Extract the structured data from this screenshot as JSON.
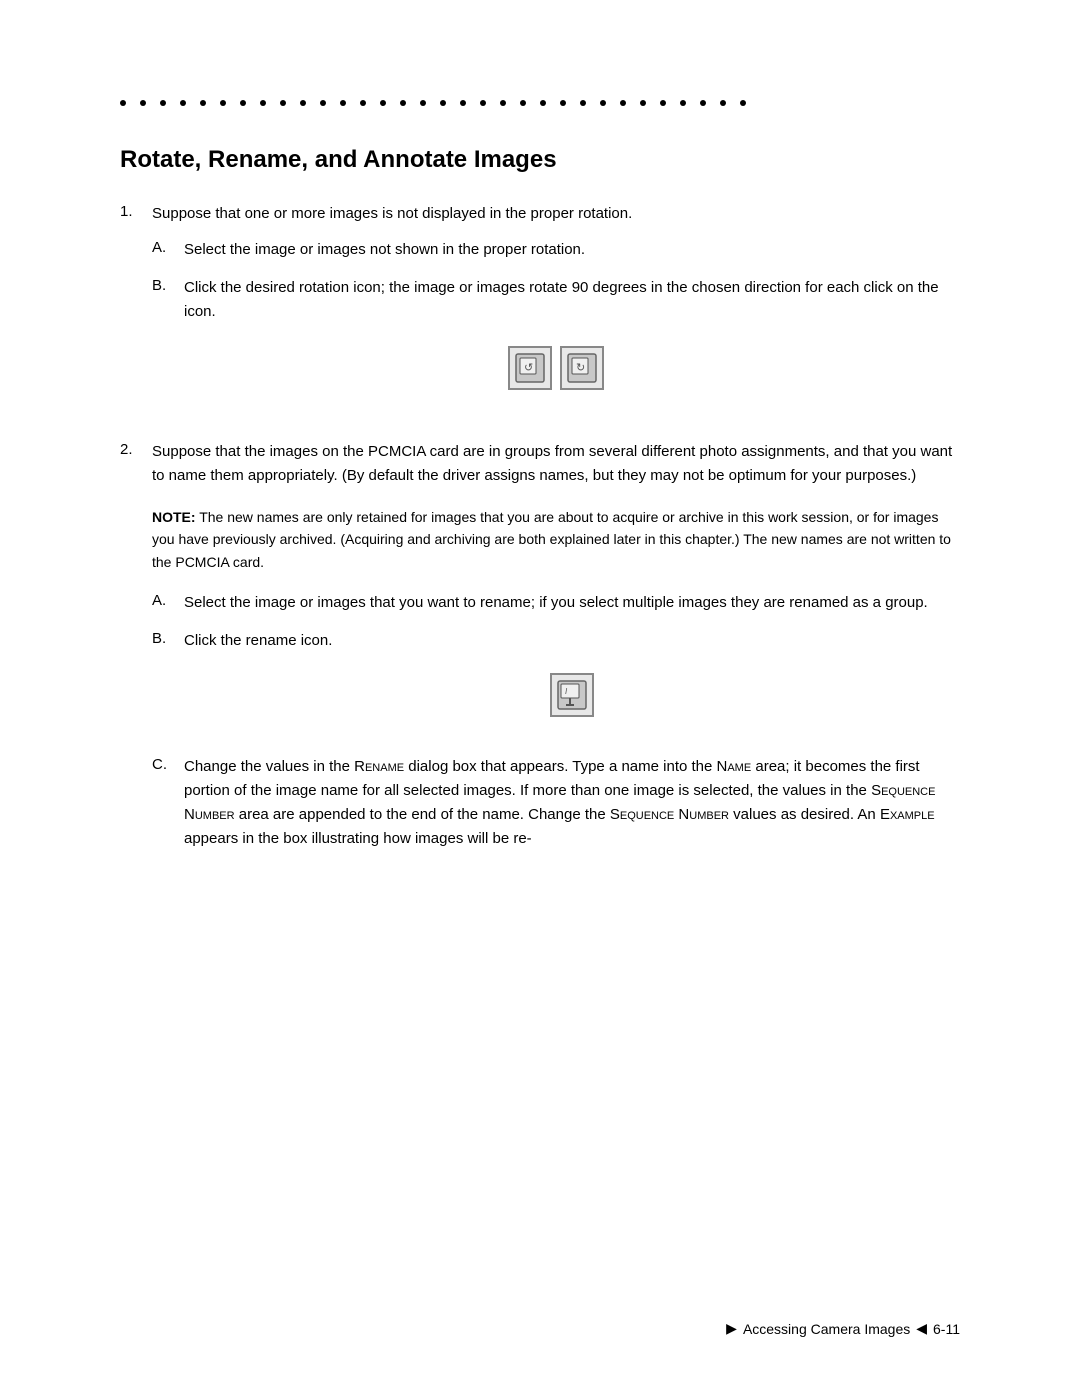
{
  "dots": {
    "count": 32
  },
  "section": {
    "title": "Rotate, Rename, and Annotate Images",
    "items": [
      {
        "number": "1.",
        "text": "Suppose that one or more images is not displayed in the proper rotation.",
        "sub_items": [
          {
            "letter": "A.",
            "text": "Select the image or images not shown in the proper rotation."
          },
          {
            "letter": "B.",
            "text": "Click the desired rotation icon; the image or images rotate 90 degrees in the chosen direction for each click on the icon."
          }
        ]
      },
      {
        "number": "2.",
        "text": "Suppose that the images on the PCMCIA card are in groups from several different photo assignments, and that you want to name them appropriately. (By default the driver assigns names, but they may not be optimum for your purposes.)",
        "note": {
          "label": "NOTE:",
          "text": " The new names are only retained for images that you are about to acquire or archive in this work session, or for images you have previously archived. (Acquiring and archiving are both explained later in this chapter.) The new names are not written to the PCMCIA card."
        },
        "sub_items": [
          {
            "letter": "A.",
            "text": "Select the image or images that you want to rename; if you select multiple images they are renamed as a group."
          },
          {
            "letter": "B.",
            "text": "Click the rename icon."
          },
          {
            "letter": "C.",
            "text_parts": [
              {
                "type": "normal",
                "text": "Change the values in the "
              },
              {
                "type": "smallcaps",
                "text": "Rename"
              },
              {
                "type": "normal",
                "text": " dialog box that appears. Type a name into the "
              },
              {
                "type": "smallcaps",
                "text": "Name"
              },
              {
                "type": "normal",
                "text": " area; it becomes the first portion of the image name for all selected images. If more than one image is selected, the values in the "
              },
              {
                "type": "smallcaps",
                "text": "Sequence Number"
              },
              {
                "type": "normal",
                "text": " area are appended to the end of the name. Change the "
              },
              {
                "type": "smallcaps",
                "text": "Sequence Number"
              },
              {
                "type": "normal",
                "text": " values as desired. An "
              },
              {
                "type": "smallcaps",
                "text": "Example"
              },
              {
                "type": "normal",
                "text": " appears in the box illustrating how images will be re-"
              }
            ]
          }
        ]
      }
    ]
  },
  "footer": {
    "arrow_right": "▶",
    "label": "Accessing Camera Images",
    "arrow_left": "◀",
    "page": "6-11"
  }
}
